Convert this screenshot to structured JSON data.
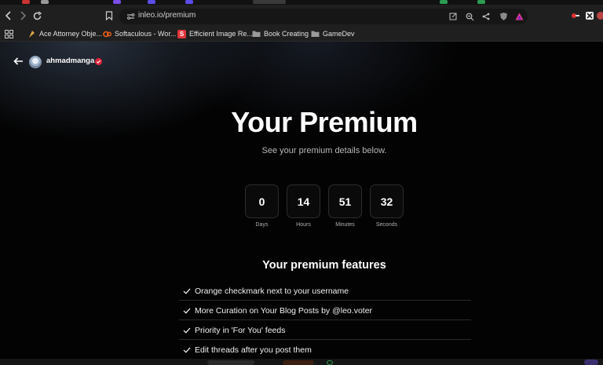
{
  "browser": {
    "url": "inleo.io/premium",
    "bookmarks": [
      {
        "label": "Ace Attorney Obje...",
        "icon": "ace-attorney-favicon-icon"
      },
      {
        "label": "Softaculous - Wor...",
        "icon": "softaculous-favicon-icon"
      },
      {
        "label": "Efficient Image Re...",
        "icon": "s-favicon-icon"
      },
      {
        "label": "Book Creating",
        "icon": "folder-icon"
      },
      {
        "label": "GameDev",
        "icon": "folder-icon"
      }
    ]
  },
  "profile": {
    "username": "ahmadmanga"
  },
  "hero": {
    "title": "Your Premium",
    "subtitle": "See your premium details below."
  },
  "countdown": [
    {
      "value": "0",
      "label": "Days"
    },
    {
      "value": "14",
      "label": "Hours"
    },
    {
      "value": "51",
      "label": "Minutes"
    },
    {
      "value": "32",
      "label": "Seconds"
    }
  ],
  "features": {
    "title": "Your premium features",
    "items": [
      "Orange checkmark next to your username",
      "More Curation on Your Blog Posts by @leo.voter",
      "Priority in 'For You' feeds",
      "Edit threads after you post them"
    ]
  },
  "colors": {
    "verified_badge": "#e0243a",
    "page_background": "#030303"
  }
}
